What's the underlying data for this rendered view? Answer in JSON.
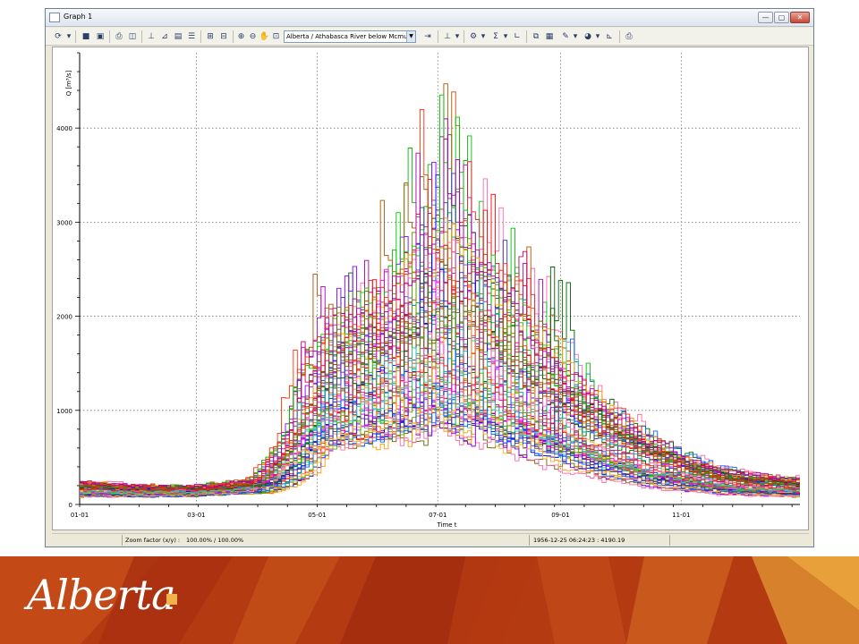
{
  "window": {
    "title": "Graph 1",
    "buttons": {
      "minimize": "—",
      "maximize": "▢",
      "close": "✕"
    }
  },
  "toolbar": {
    "station_selected": "Alberta / Athabasca River below Mcmu",
    "icons": [
      "refresh-icon",
      "save-icon",
      "save-all-icon",
      "print-icon",
      "print-preview-icon",
      "axis-icon",
      "chart-icon",
      "table-icon",
      "list-icon",
      "grid-icon",
      "compare-icon",
      "zoom-in-icon",
      "zoom-out-icon",
      "pan-icon",
      "zoom-extent-icon",
      "export-icon",
      "settings-icon",
      "statistics-icon",
      "sum-icon",
      "baseline-icon",
      "copy-icon",
      "paste-icon",
      "draw-icon",
      "color-icon",
      "axis-scale-icon",
      "print-small-icon"
    ]
  },
  "status": {
    "zoom_label": "Zoom factor (x/y) :",
    "zoom_value": "100.00% / 100.00%",
    "cursor_readout": "1956-12-25 06:24:23 : 4190.19"
  },
  "brand": {
    "logo_text": "Alberta",
    "banner_color": "#b43a12",
    "accent": "#f1b24a"
  },
  "chart_data": {
    "type": "line",
    "ylabel": "Q [m³/s]",
    "xlabel": "Time t",
    "xlim": [
      "01-01",
      "12-31"
    ],
    "ylim": [
      0,
      4800
    ],
    "yticks": [
      0,
      1000,
      2000,
      3000,
      4000
    ],
    "xticks": [
      "01-01",
      "03-01",
      "05-01",
      "07-01",
      "09-01",
      "11-01"
    ],
    "grid": true,
    "series_count": 60,
    "description_of_series": "many annual hydrographs overlaid",
    "envelope": {
      "days": [
        1,
        30,
        60,
        90,
        105,
        115,
        121,
        135,
        150,
        165,
        182,
        196,
        210,
        225,
        245,
        265,
        285,
        305,
        330,
        365
      ],
      "low": [
        80,
        80,
        90,
        120,
        200,
        400,
        550,
        600,
        620,
        650,
        700,
        680,
        600,
        520,
        380,
        280,
        200,
        150,
        100,
        80
      ],
      "mid": [
        170,
        150,
        150,
        200,
        450,
        800,
        1000,
        1100,
        1200,
        1350,
        1400,
        1350,
        1200,
        1050,
        850,
        650,
        480,
        330,
        230,
        180
      ],
      "high": [
        300,
        250,
        230,
        320,
        900,
        2000,
        2700,
        2800,
        3000,
        3900,
        4500,
        4600,
        3500,
        3000,
        2000,
        1500,
        1000,
        650,
        420,
        350
      ]
    },
    "colors": [
      "#ff0000",
      "#0000ff",
      "#00c000",
      "#ff00ff",
      "#ff9900",
      "#00aaaa",
      "#8000ff",
      "#ff66aa",
      "#006400",
      "#aa5500",
      "#0066ff",
      "#cc0066",
      "#55aa00",
      "#ff3300",
      "#3333aa",
      "#aa00aa",
      "#33cc99",
      "#ffaa33",
      "#666600",
      "#dd2222"
    ]
  }
}
